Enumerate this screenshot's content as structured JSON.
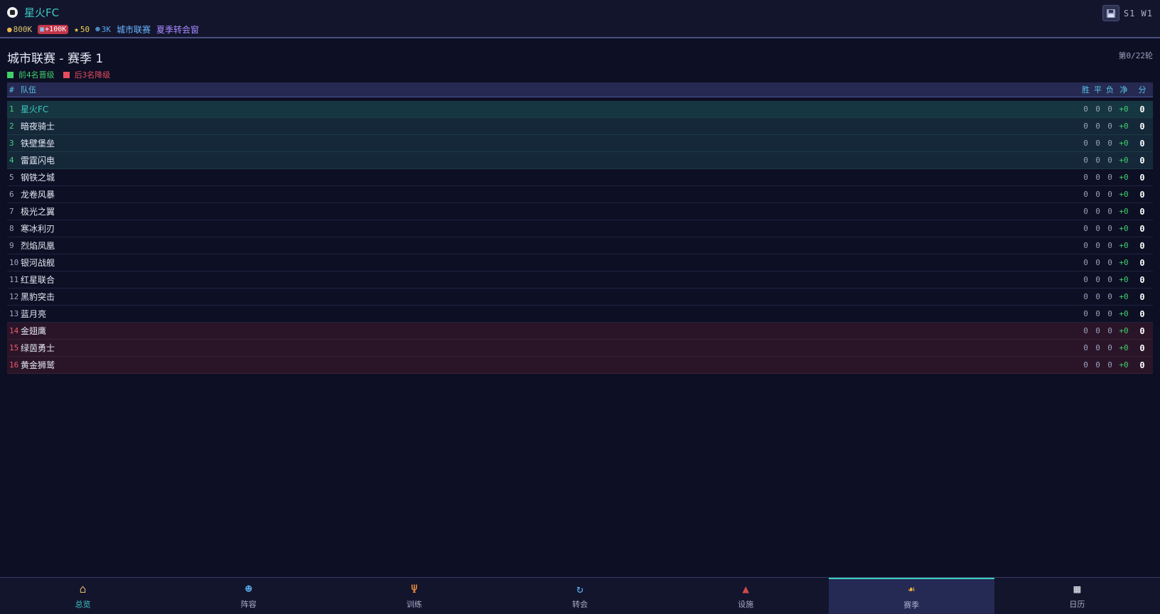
{
  "header": {
    "team_name": "星火FC",
    "money": "800K",
    "fans": "+100K",
    "rating": "50",
    "members": "3K",
    "league": "城市联赛",
    "window": "夏季转会窗",
    "season_week": "S1 W1",
    "icons": {
      "team_logo": "soccer-ball-icon",
      "money": "money-bag-icon",
      "fans": "tv-icon",
      "rating": "star-icon",
      "members": "people-icon",
      "save": "floppy-disk-icon"
    }
  },
  "page": {
    "title": "城市联赛 - 赛季 1",
    "round": "第0/22轮",
    "legend_promo": "前4名晋级",
    "legend_releg": "后3名降级",
    "promo_color": "#3fd06a",
    "releg_color": "#e74c5e"
  },
  "table": {
    "headers": {
      "rank": "#",
      "team": "队伍",
      "win": "胜",
      "draw": "平",
      "loss": "负",
      "gd": "净",
      "pts": "分"
    },
    "rows": [
      {
        "rank": "1",
        "team": "星火FC",
        "w": "0",
        "d": "0",
        "l": "0",
        "gd": "+0",
        "pts": "0"
      },
      {
        "rank": "2",
        "team": "暗夜骑士",
        "w": "0",
        "d": "0",
        "l": "0",
        "gd": "+0",
        "pts": "0"
      },
      {
        "rank": "3",
        "team": "铁壁堡垒",
        "w": "0",
        "d": "0",
        "l": "0",
        "gd": "+0",
        "pts": "0"
      },
      {
        "rank": "4",
        "team": "雷霆闪电",
        "w": "0",
        "d": "0",
        "l": "0",
        "gd": "+0",
        "pts": "0"
      },
      {
        "rank": "5",
        "team": "钢铁之城",
        "w": "0",
        "d": "0",
        "l": "0",
        "gd": "+0",
        "pts": "0"
      },
      {
        "rank": "6",
        "team": "龙卷风暴",
        "w": "0",
        "d": "0",
        "l": "0",
        "gd": "+0",
        "pts": "0"
      },
      {
        "rank": "7",
        "team": "极光之翼",
        "w": "0",
        "d": "0",
        "l": "0",
        "gd": "+0",
        "pts": "0"
      },
      {
        "rank": "8",
        "team": "寒冰利刃",
        "w": "0",
        "d": "0",
        "l": "0",
        "gd": "+0",
        "pts": "0"
      },
      {
        "rank": "9",
        "team": "烈焰凤凰",
        "w": "0",
        "d": "0",
        "l": "0",
        "gd": "+0",
        "pts": "0"
      },
      {
        "rank": "10",
        "team": "银河战舰",
        "w": "0",
        "d": "0",
        "l": "0",
        "gd": "+0",
        "pts": "0"
      },
      {
        "rank": "11",
        "team": "红星联合",
        "w": "0",
        "d": "0",
        "l": "0",
        "gd": "+0",
        "pts": "0"
      },
      {
        "rank": "12",
        "team": "黑豹突击",
        "w": "0",
        "d": "0",
        "l": "0",
        "gd": "+0",
        "pts": "0"
      },
      {
        "rank": "13",
        "team": "蓝月亮",
        "w": "0",
        "d": "0",
        "l": "0",
        "gd": "+0",
        "pts": "0"
      },
      {
        "rank": "14",
        "team": "金翅鹰",
        "w": "0",
        "d": "0",
        "l": "0",
        "gd": "+0",
        "pts": "0"
      },
      {
        "rank": "15",
        "team": "绿茵勇士",
        "w": "0",
        "d": "0",
        "l": "0",
        "gd": "+0",
        "pts": "0"
      },
      {
        "rank": "16",
        "team": "黄金狮鹫",
        "w": "0",
        "d": "0",
        "l": "0",
        "gd": "+0",
        "pts": "0"
      }
    ]
  },
  "nav": {
    "items": [
      {
        "label": "总览",
        "icon": "home-icon"
      },
      {
        "label": "阵容",
        "icon": "team-icon"
      },
      {
        "label": "训练",
        "icon": "training-icon"
      },
      {
        "label": "转会",
        "icon": "transfer-icon"
      },
      {
        "label": "设施",
        "icon": "facility-icon"
      },
      {
        "label": "赛季",
        "icon": "trophy-icon"
      },
      {
        "label": "日历",
        "icon": "calendar-icon"
      }
    ],
    "accent": "#3ccdc0"
  }
}
